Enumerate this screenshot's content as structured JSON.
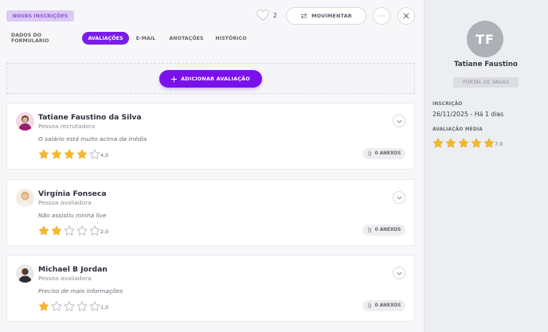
{
  "header": {
    "badge": "NOVAS INSCRIÇÕES",
    "favorite_count": "2",
    "move_label": "MOVIMENTAR"
  },
  "tabs": [
    {
      "label": "DADOS DO FORMULÁRIO",
      "active": false
    },
    {
      "label": "AVALIAÇÕES",
      "active": true
    },
    {
      "label": "E-MAIL",
      "active": false
    },
    {
      "label": "ANOTAÇÕES",
      "active": false
    },
    {
      "label": "HISTÓRICO",
      "active": false
    }
  ],
  "add_button": "ADICIONAR AVALIAÇÃO",
  "evaluations": [
    {
      "name": "Tatiane Faustino da Silva",
      "role": "Pessoa recrutadora",
      "comment": "O salário está muito acima da média",
      "rating": 4,
      "score": "4,0",
      "attachments": "0 ANEXOS"
    },
    {
      "name": "Virgínia Fonseca",
      "role": "Pessoa avaliadora",
      "comment": "Não assistiu minha live",
      "rating": 2,
      "score": "2,0",
      "attachments": "0 ANEXOS"
    },
    {
      "name": "Michael B Jordan",
      "role": "Pessoa avaliadora",
      "comment": "Preciso de mais informações",
      "rating": 1,
      "score": "1,0",
      "attachments": "0 ANEXOS"
    }
  ],
  "sidebar": {
    "initials": "TF",
    "name": "Tatiane Faustino",
    "source": "PORTAL DE VAGAS",
    "inscription_label": "INSCRIÇÃO",
    "inscription_value": "26/11/2025 - Há 1 dias",
    "avg_label": "AVALIAÇÃO MÉDIA",
    "avg_rating": 5,
    "avg_score": "7.0"
  },
  "colors": {
    "accent": "#7b1de8",
    "star": "#f5b82e",
    "star_empty": "#b5b5be"
  }
}
